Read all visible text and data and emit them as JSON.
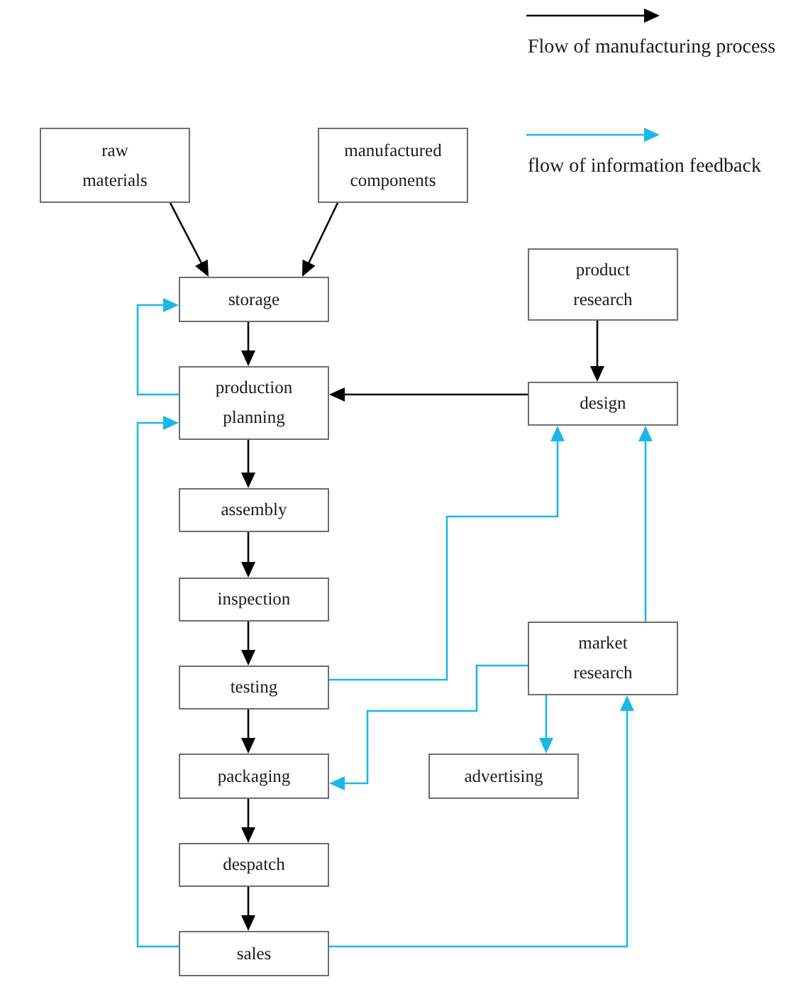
{
  "legend": [
    {
      "kind": "process",
      "label": "Flow of manufacturing process"
    },
    {
      "kind": "information",
      "label": "flow of information feedback"
    }
  ],
  "nodes": [
    {
      "lines": [
        "raw",
        "materials"
      ]
    },
    {
      "lines": [
        "manufactured",
        "components"
      ]
    },
    {
      "lines": [
        "storage"
      ]
    },
    {
      "lines": [
        "production",
        "planning"
      ]
    },
    {
      "lines": [
        "assembly"
      ]
    },
    {
      "lines": [
        "inspection"
      ]
    },
    {
      "lines": [
        "testing"
      ]
    },
    {
      "lines": [
        "packaging"
      ]
    },
    {
      "lines": [
        "despatch"
      ]
    },
    {
      "lines": [
        "sales"
      ]
    },
    {
      "lines": [
        "product",
        "research"
      ]
    },
    {
      "lines": [
        "design"
      ]
    },
    {
      "lines": [
        "market",
        "research"
      ]
    },
    {
      "lines": [
        "advertising"
      ]
    }
  ],
  "flows": [
    {
      "kind": "process"
    },
    {
      "kind": "process"
    },
    {
      "kind": "process"
    },
    {
      "kind": "process"
    },
    {
      "kind": "process"
    },
    {
      "kind": "process"
    },
    {
      "kind": "process"
    },
    {
      "kind": "process"
    },
    {
      "kind": "process"
    },
    {
      "kind": "process"
    },
    {
      "kind": "process"
    },
    {
      "kind": "information"
    },
    {
      "kind": "information"
    },
    {
      "kind": "information"
    },
    {
      "kind": "information"
    },
    {
      "kind": "information"
    },
    {
      "kind": "information"
    },
    {
      "kind": "information"
    }
  ]
}
